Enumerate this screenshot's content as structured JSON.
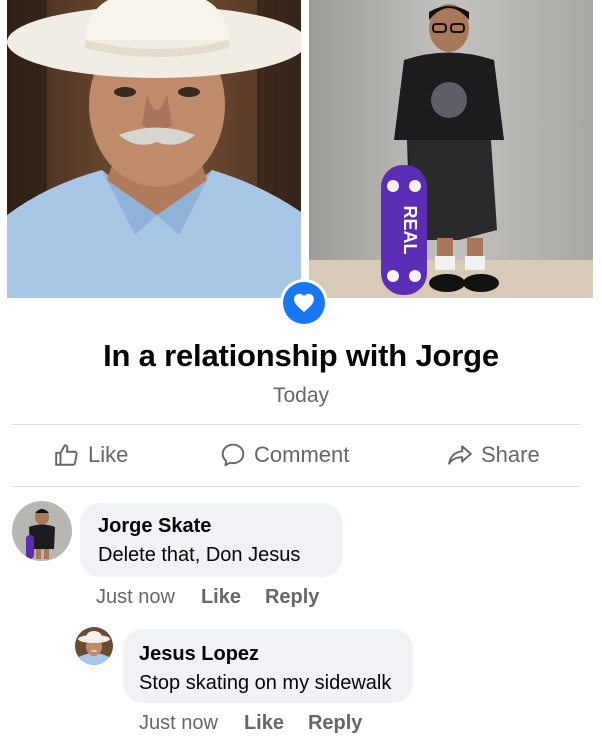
{
  "relationship": {
    "title": "In a relationship with Jorge",
    "date": "Today",
    "board_text": "REAL"
  },
  "actions": {
    "like": "Like",
    "comment": "Comment",
    "share": "Share"
  },
  "comments": [
    {
      "author": "Jorge Skate",
      "text": "Delete that, Don Jesus",
      "time": "Just now",
      "like": "Like",
      "reply": "Reply"
    },
    {
      "author": "Jesus Lopez",
      "text": "Stop skating on my sidewalk",
      "time": "Just now",
      "like": "Like",
      "reply": "Reply"
    }
  ],
  "colors": {
    "accent": "#1877f2",
    "muted_text": "#65676b",
    "bubble": "#f0f2f5"
  },
  "icons": [
    "heart-badge-icon",
    "like-thumb-icon",
    "comment-bubble-icon",
    "share-arrow-icon"
  ]
}
